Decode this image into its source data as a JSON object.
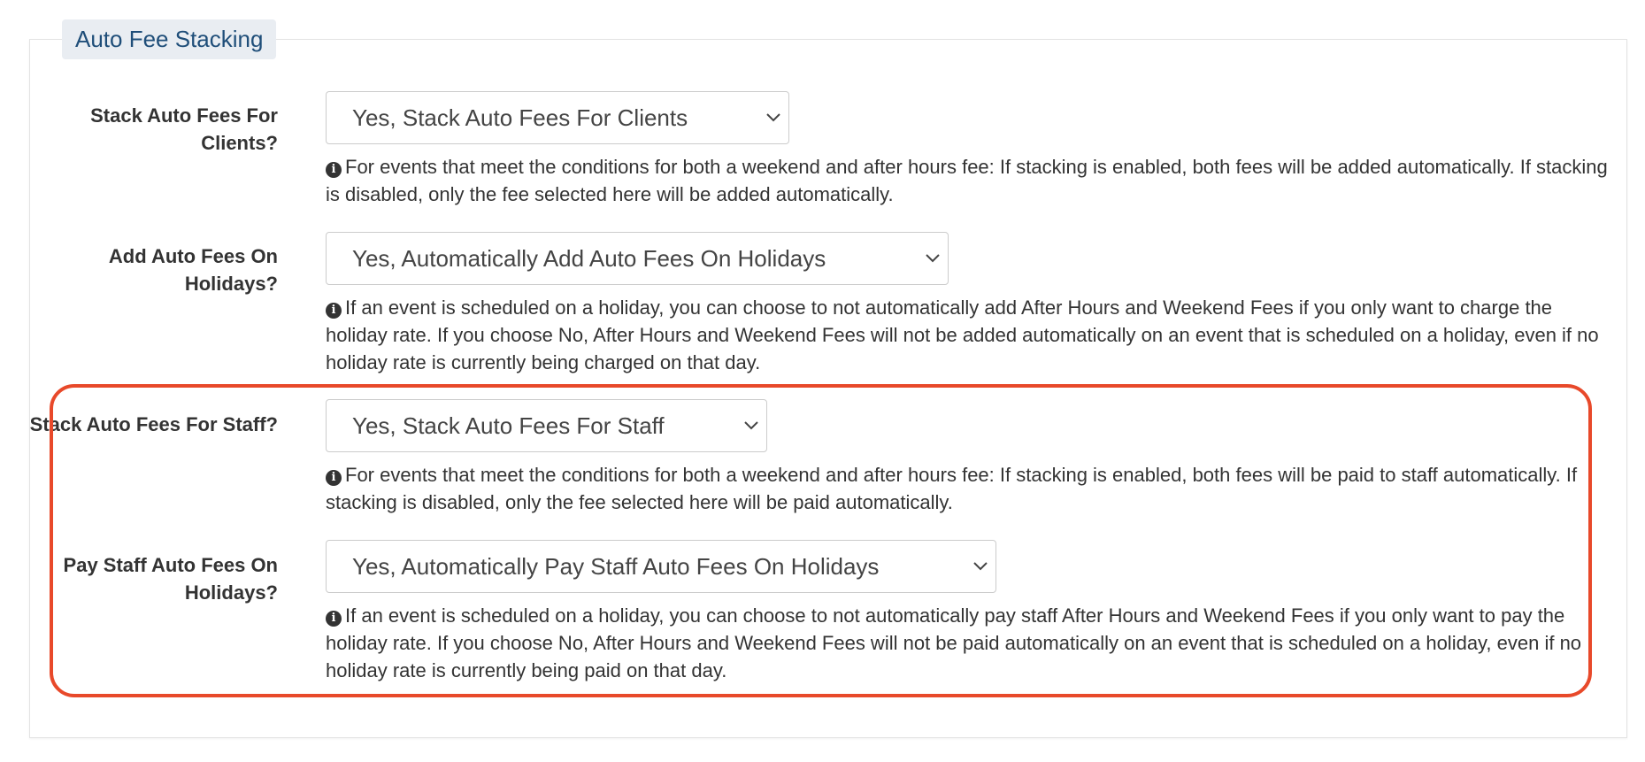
{
  "section": {
    "legend": "Auto Fee Stacking"
  },
  "fields": [
    {
      "label": "Stack Auto Fees For Clients?",
      "selected": "Yes, Stack Auto Fees For Clients",
      "help": "For events that meet the conditions for both a weekend and after hours fee: If stacking is enabled, both fees will be added automatically. If stacking is disabled, only the fee selected here will be added automatically."
    },
    {
      "label": "Add Auto Fees On Holidays?",
      "selected": "Yes, Automatically Add Auto Fees On Holidays",
      "help": "If an event is scheduled on a holiday, you can choose to not automatically add After Hours and Weekend Fees if you only want to charge the holiday rate. If you choose No, After Hours and Weekend Fees will not be added automatically on an event that is scheduled on a holiday, even if no holiday rate is currently being charged on that day."
    },
    {
      "label": "Stack Auto Fees For Staff?",
      "selected": "Yes, Stack Auto Fees For Staff",
      "help": "For events that meet the conditions for both a weekend and after hours fee: If stacking is enabled, both fees will be paid to staff automatically. If stacking is disabled, only the fee selected here will be paid automatically."
    },
    {
      "label": "Pay Staff Auto Fees On Holidays?",
      "selected": "Yes, Automatically Pay Staff Auto Fees On Holidays",
      "help": "If an event is scheduled on a holiday, you can choose to not automatically pay staff After Hours and Weekend Fees if you only want to pay the holiday rate. If you choose No, After Hours and Weekend Fees will not be paid automatically on an event that is scheduled on a holiday, even if no holiday rate is currently being paid on that day."
    }
  ],
  "colors": {
    "highlight": "#e8492a",
    "legend_text": "#1f4e79",
    "legend_bg": "#e9edf2"
  },
  "icons": {
    "help": "info-circle-icon",
    "select": "chevron-down-icon"
  }
}
